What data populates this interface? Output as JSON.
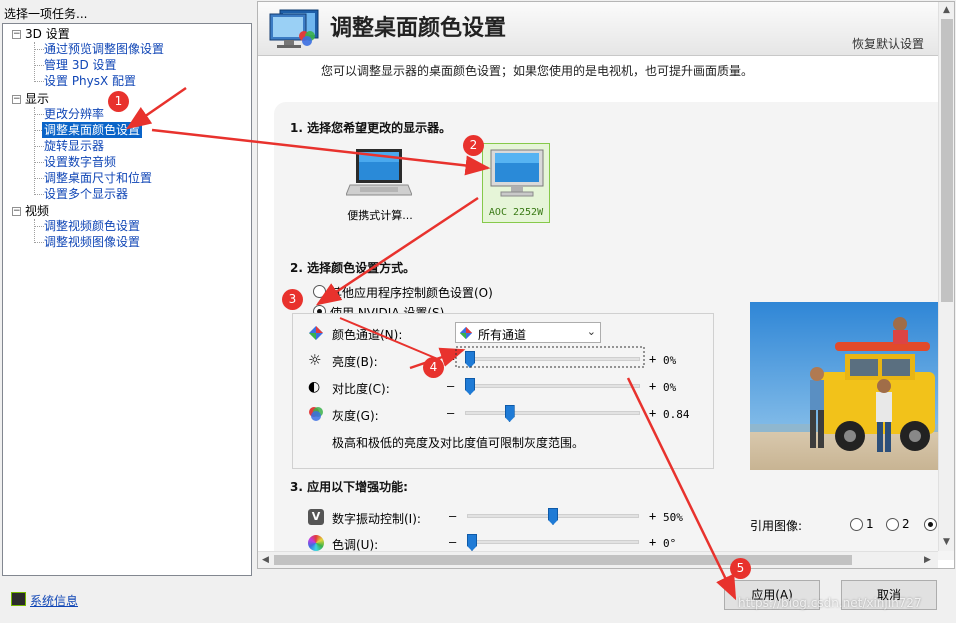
{
  "task_label": "选择一项任务...",
  "tree": {
    "groups": [
      {
        "label": "3D 设置",
        "items": [
          "通过预览调整图像设置",
          "管理 3D 设置",
          "设置 PhysX 配置"
        ]
      },
      {
        "label": "显示",
        "items": [
          "更改分辨率",
          "调整桌面颜色设置",
          "旋转显示器",
          "设置数字音频",
          "调整桌面尺寸和位置",
          "设置多个显示器"
        ]
      },
      {
        "label": "视频",
        "items": [
          "调整视频颜色设置",
          "调整视频图像设置"
        ]
      }
    ],
    "selected": "调整桌面颜色设置"
  },
  "header": {
    "title": "调整桌面颜色设置",
    "restore_defaults": "恢复默认设置"
  },
  "description": "您可以调整显示器的桌面颜色设置；如果您使用的是电视机，也可提升画面质量。",
  "section1": {
    "title": "1. 选择您希望更改的显示器。",
    "displays": [
      {
        "label": "便携式计算...",
        "icon": "laptop-icon"
      },
      {
        "label": "AOC 2252W",
        "icon": "monitor-icon",
        "selected": true
      }
    ]
  },
  "section2": {
    "title": "2. 选择颜色设置方式。",
    "option_other": "其他应用程序控制颜色设置(O)",
    "option_nvidia": "使用 NVIDIA 设置(S)",
    "channel_label": "颜色通道(N):",
    "channel_value": "所有通道",
    "brightness": {
      "label": "亮度(B):",
      "minus": "–",
      "plus": "+",
      "value": "0%",
      "level": 0
    },
    "contrast": {
      "label": "对比度(C):",
      "minus": "–",
      "plus": "+",
      "value": "0%",
      "level": 0
    },
    "gamma": {
      "label": "灰度(G):",
      "minus": "–",
      "plus": "+",
      "value": "0.84",
      "level": 0.24
    },
    "note": "极高和极低的亮度及对比度值可限制灰度范围。"
  },
  "section3": {
    "title": "3. 应用以下增强功能:",
    "vibrance": {
      "label": "数字振动控制(I):",
      "minus": "–",
      "plus": "+",
      "value": "50%",
      "level": 0.5
    },
    "hue": {
      "label": "色调(U):",
      "minus": "–",
      "plus": "+",
      "value": "0°",
      "level": 0
    }
  },
  "reference": {
    "label": "引用图像:",
    "options": [
      "1",
      "2",
      "3"
    ],
    "selected": "3"
  },
  "bottom": {
    "sysinfo": "系统信息",
    "apply": "应用(A)",
    "cancel": "取消"
  },
  "annotations": [
    "1",
    "2",
    "3",
    "4",
    "5"
  ],
  "watermark": "https://blog.csdn.net/xinjin727",
  "colors": {
    "accent": "#0a64c8",
    "nvidia_green": "#76b900",
    "annotation_red": "#e8322d",
    "link": "#1046b6"
  }
}
